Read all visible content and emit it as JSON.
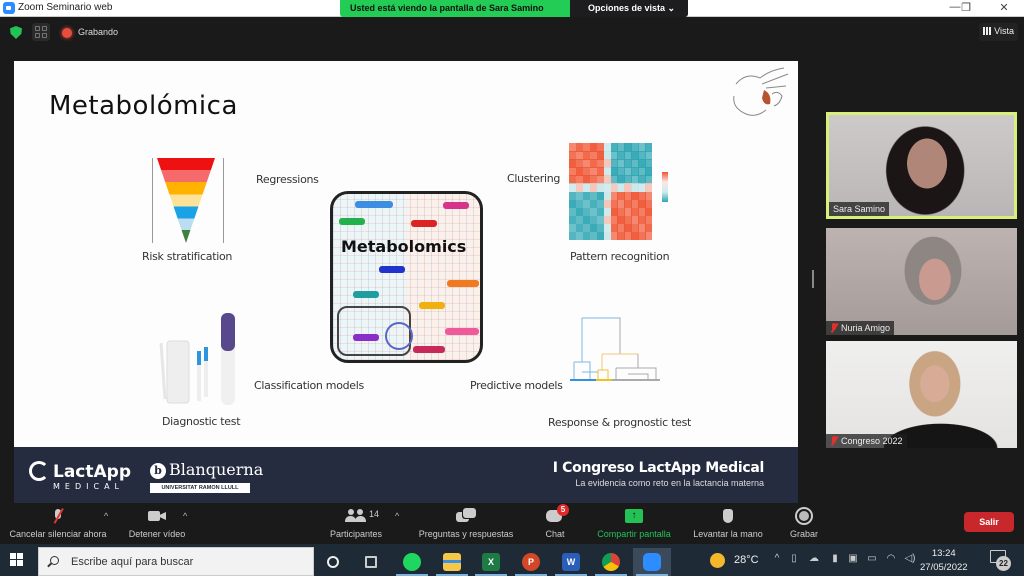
{
  "window": {
    "title": "Zoom Seminario web",
    "share_banner": "Usted está viendo la pantalla de Sara Samino",
    "view_options": "Opciones de vista ⌄",
    "controls": {
      "minimize": "—",
      "restore": "❐",
      "close": "✕"
    }
  },
  "topbar": {
    "recording_label": "Grabando",
    "view_label": "Vista",
    "icons": [
      "shield-check-icon",
      "grid-apps-icon",
      "recording-dot-icon"
    ]
  },
  "slide": {
    "title": "Metabolómica",
    "center_label": "Metabolomics",
    "labels": {
      "regressions": "Regressions",
      "risk_stratification": "Risk stratification",
      "clustering": "Clustering",
      "pattern_recognition": "Pattern recognition",
      "classification_models": "Classification models",
      "diagnostic_test": "Diagnostic test",
      "predictive_models": "Predictive models",
      "response_prognostic": "Response & prognostic test"
    },
    "footer": {
      "lactapp": "LactApp",
      "lactapp_sub": "MEDICAL",
      "blanquerna": "Blanquerna",
      "blanquerna_sub": "UNIVERSITAT RAMON LLULL",
      "congress_title": "I Congreso LactApp Medical",
      "congress_subtitle": "La evidencia como reto en la lactancia materna"
    },
    "colors": {
      "footer_bg": "#252c3f",
      "heat_hot": "#ef5533",
      "heat_cold": "#2fa6b3"
    }
  },
  "participants_videos": [
    {
      "name": "Sara Samino",
      "muted": false,
      "active_speaker": true
    },
    {
      "name": "Nuria Amigo",
      "muted": true,
      "active_speaker": false
    },
    {
      "name": "Congreso 2022",
      "muted": true,
      "active_speaker": false
    }
  ],
  "toolbar": {
    "unmute": "Cancelar silenciar ahora",
    "stop_video": "Detener vídeo",
    "participants": "Participantes",
    "participants_count": "14",
    "qa": "Preguntas y respuestas",
    "chat": "Chat",
    "chat_badge": "5",
    "share_screen": "Compartir pantalla",
    "raise_hand": "Levantar la mano",
    "record": "Grabar",
    "leave": "Salir",
    "caret": "^",
    "share_arrow": "↑",
    "accent_green": "#23c257",
    "leave_color": "#c8282b"
  },
  "taskbar": {
    "search_placeholder": "Escribe aquí para buscar",
    "apps": [
      "Spotify",
      "File Explorer",
      "Excel",
      "PowerPoint",
      "Word",
      "Chrome",
      "Zoom"
    ],
    "app_letters": {
      "excel": "X",
      "powerpoint": "P",
      "word": "W"
    },
    "weather_temp": "28°C",
    "time": "13:24",
    "date": "27/05/2022",
    "notifications_count": "22",
    "tray_icons": [
      "chevron-up-icon",
      "meet-now-icon",
      "onedrive-error-icon",
      "microphone-icon",
      "security-icon",
      "battery-icon",
      "wifi-icon",
      "volume-icon"
    ],
    "tray_glyphs": [
      "^",
      "▯",
      "☁",
      "▮",
      "▣",
      "▭",
      "◠",
      "◁)"
    ]
  }
}
